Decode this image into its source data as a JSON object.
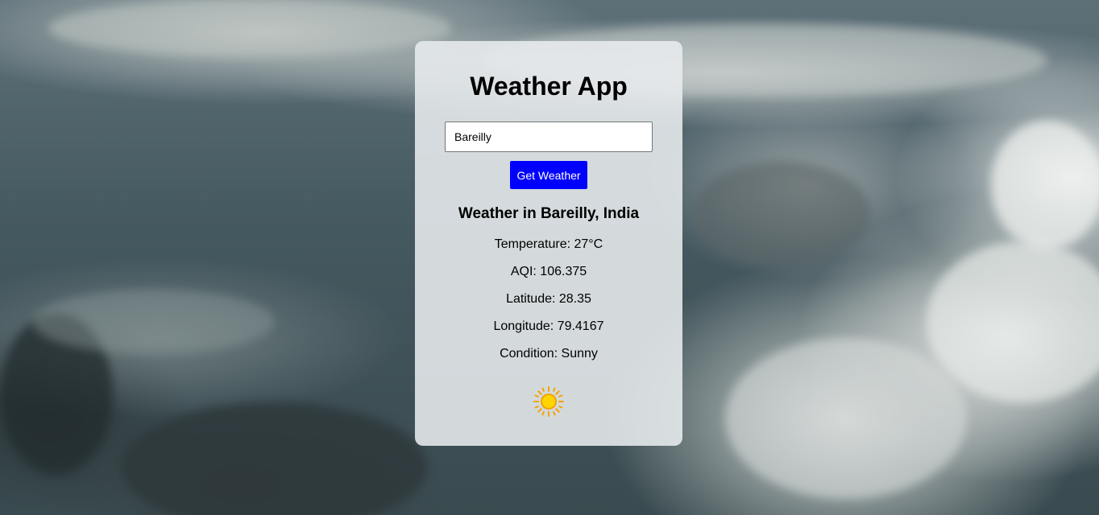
{
  "app": {
    "title": "Weather App"
  },
  "search": {
    "value": "Bareilly",
    "button_label": "Get Weather"
  },
  "result": {
    "heading": "Weather in Bareilly, India",
    "temperature": "Temperature: 27°C",
    "aqi": "AQI: 106.375",
    "latitude": "Latitude: 28.35",
    "longitude": "Longitude: 79.4167",
    "condition": "Condition: Sunny",
    "condition_icon": "sun-icon"
  },
  "colors": {
    "button_bg": "#0000ff",
    "button_text": "#ffffff",
    "sun": "#ffd400",
    "sun_rays": "#f4a300"
  }
}
